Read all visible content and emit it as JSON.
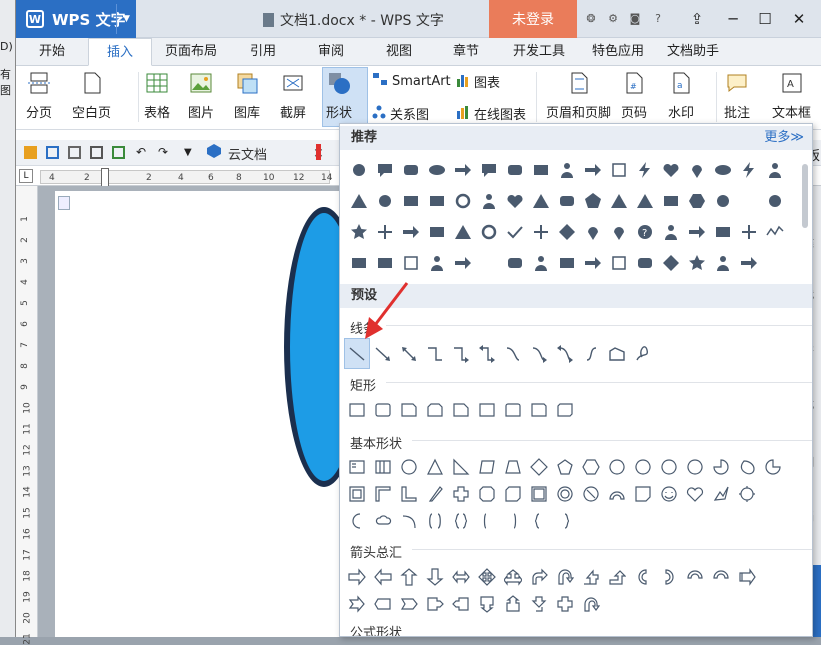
{
  "desktop": {
    "left_texts": [
      "D)",
      "有图"
    ]
  },
  "titlebar": {
    "app_button": "WPS 文字",
    "doc_title": "文档1.docx * - WPS 文字",
    "login": "未登录"
  },
  "tabs": [
    "开始",
    "插入",
    "页面布局",
    "引用",
    "审阅",
    "视图",
    "章节",
    "开发工具",
    "特色应用",
    "文档助手"
  ],
  "ribbon": {
    "buttons": [
      {
        "label": "分页"
      },
      {
        "label": "空白页"
      },
      {
        "label": "表格"
      },
      {
        "label": "图片"
      },
      {
        "label": "图库"
      },
      {
        "label": "截屏"
      },
      {
        "label": "形状"
      }
    ],
    "smartart": "SmartArt",
    "chart": "图表",
    "relation": "关系图",
    "online_chart": "在线图表",
    "header_footer": "页眉和页脚",
    "page_num": "页码",
    "watermark": "水印",
    "comment": "批注",
    "textbox": "文本框"
  },
  "quickbar": {
    "cloud_doc": "云文档",
    "close": "×",
    "right_cut": "板"
  },
  "ruler": {
    "h_numbers": [
      "4",
      "2",
      "2",
      "4",
      "6",
      "8",
      "10",
      "12",
      "14"
    ],
    "v_numbers": [
      "1",
      "2",
      "3",
      "4",
      "5",
      "6",
      "7",
      "8",
      "9",
      "10",
      "11",
      "12",
      "13",
      "14",
      "15",
      "16",
      "17",
      "18",
      "19",
      "20",
      "21"
    ]
  },
  "right_strip": [
    "键",
    "代",
    "叠",
    "式",
    "制",
    "档",
    "注"
  ],
  "panel": {
    "recommend": "推荐",
    "more": "更多≫",
    "preset": "预设",
    "sections": {
      "lines": "线条",
      "rect": "矩形",
      "basic": "基本形状",
      "arrows": "箭头总汇",
      "formula": "公式形状"
    }
  },
  "colors": {
    "accent": "#2b6fc4",
    "login_bg": "#ea7c5a",
    "shape_blue": "#1d9ce6",
    "arrow_red": "#e0302e"
  }
}
